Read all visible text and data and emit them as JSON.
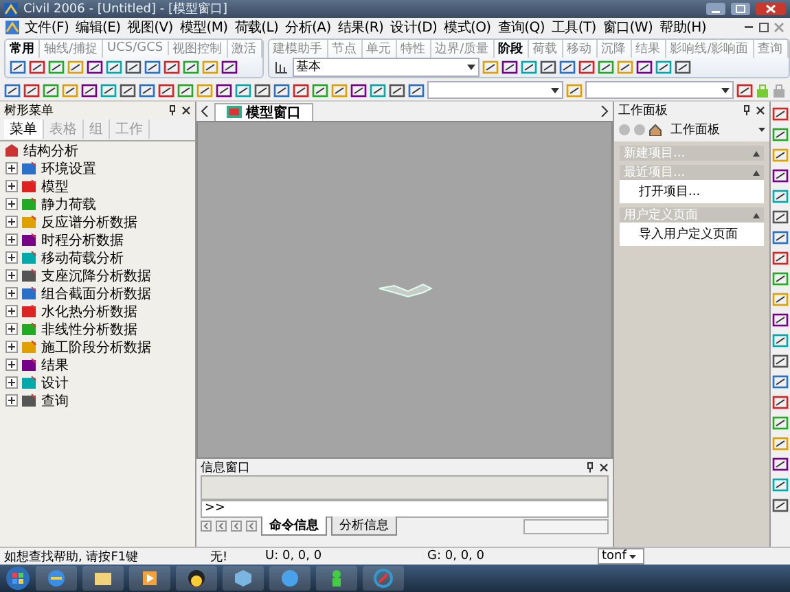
{
  "window": {
    "title": "Civil 2006 - [Untitled] - [模型窗口]"
  },
  "menu": [
    "文件(F)",
    "编辑(E)",
    "视图(V)",
    "模型(M)",
    "荷载(L)",
    "分析(A)",
    "结果(R)",
    "设计(D)",
    "模式(O)",
    "查询(Q)",
    "工具(T)",
    "窗口(W)",
    "帮助(H)"
  ],
  "ribbon_left": {
    "tabs": [
      {
        "label": "常用",
        "selected": true
      },
      {
        "label": "轴线/捕捉",
        "selected": false
      },
      {
        "label": "UCS/GCS",
        "selected": false
      },
      {
        "label": "视图控制",
        "selected": false
      },
      {
        "label": "激活",
        "selected": false
      }
    ]
  },
  "ribbon_right": {
    "tabs": [
      {
        "label": "建模助手",
        "selected": false
      },
      {
        "label": "节点",
        "selected": false
      },
      {
        "label": "单元",
        "selected": false
      },
      {
        "label": "特性",
        "selected": false
      },
      {
        "label": "边界/质量",
        "selected": false
      },
      {
        "label": "阶段",
        "selected": true
      },
      {
        "label": "荷载",
        "selected": false
      },
      {
        "label": "移动",
        "selected": false
      },
      {
        "label": "沉降",
        "selected": false
      },
      {
        "label": "结果",
        "selected": false
      },
      {
        "label": "影响线/影响面",
        "selected": false
      },
      {
        "label": "查询",
        "selected": false
      }
    ],
    "combo": "基本"
  },
  "tree_panel": {
    "title": "树形菜单",
    "tabs": [
      {
        "label": "菜单",
        "selected": true
      },
      {
        "label": "表格",
        "selected": false
      },
      {
        "label": "组",
        "selected": false
      },
      {
        "label": "工作",
        "selected": false
      }
    ],
    "root": "结构分析",
    "items": [
      {
        "label": "环境设置",
        "expanded": false
      },
      {
        "label": "模型",
        "expanded": false
      },
      {
        "label": "静力荷载",
        "expanded": false
      },
      {
        "label": "反应谱分析数据",
        "expanded": false
      },
      {
        "label": "时程分析数据",
        "expanded": false
      },
      {
        "label": "移动荷载分析",
        "expanded": false
      },
      {
        "label": "支座沉降分析数据",
        "expanded": false
      },
      {
        "label": "组合截面分析数据",
        "expanded": false
      },
      {
        "label": "水化热分析数据",
        "expanded": false
      },
      {
        "label": "非线性分析数据",
        "expanded": false
      },
      {
        "label": "施工阶段分析数据",
        "expanded": false
      },
      {
        "label": "结果",
        "expanded": false
      },
      {
        "label": "设计",
        "expanded": false
      },
      {
        "label": "查询",
        "expanded": false
      }
    ]
  },
  "model_window": {
    "tab": "模型窗口"
  },
  "work_panel": {
    "title": "工作面板",
    "combo": "工作面板",
    "sections": [
      {
        "title": "新建项目..."
      },
      {
        "title": "最近项目...",
        "items": [
          "打开项目..."
        ]
      },
      {
        "title": "用户定义页面",
        "items": [
          "导入用户定义页面"
        ]
      }
    ]
  },
  "info_window": {
    "title": "信息窗口",
    "prompt": ">>",
    "tabs": [
      {
        "label": "命令信息",
        "selected": true
      },
      {
        "label": "分析信息",
        "selected": false
      }
    ]
  },
  "status_bar": {
    "help": "如想查找帮助, 请按F1键",
    "message": "无!",
    "ucs": "U: 0, 0, 0",
    "gcs": "G: 0, 0, 0",
    "unit": "tonf"
  }
}
